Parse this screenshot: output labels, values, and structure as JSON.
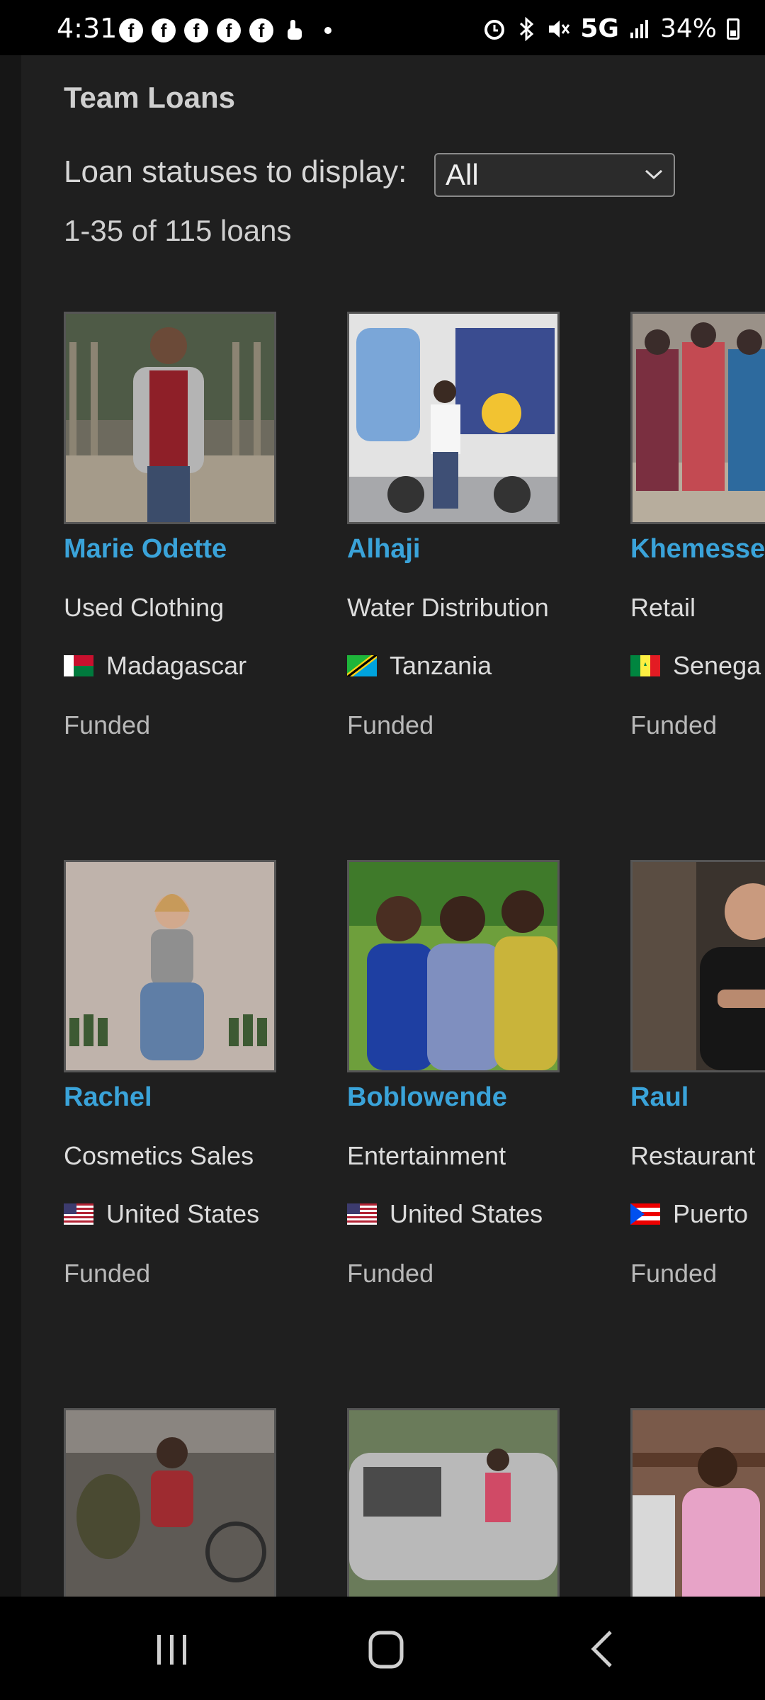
{
  "status_bar": {
    "time": "4:31",
    "network": "5G",
    "battery": "34%",
    "notification_icons": [
      "facebook-icon",
      "facebook-icon",
      "facebook-icon",
      "facebook-icon",
      "facebook-icon",
      "touch-icon"
    ]
  },
  "page": {
    "title": "Team Loans",
    "filter_label": "Loan statuses to display:",
    "filter_value": "All",
    "results_count": "1-35 of 115 loans"
  },
  "loans": [
    {
      "name": "Marie Odette",
      "sector": "Used Clothing",
      "country": "Madagascar",
      "status": "Funded",
      "flag": "madagascar"
    },
    {
      "name": "Alhaji",
      "sector": "Water Distribution",
      "country": "Tanzania",
      "status": "Funded",
      "flag": "tanzania"
    },
    {
      "name": "Khemesse",
      "sector": "Retail",
      "country": "Senega",
      "status": "Funded",
      "flag": "senegal"
    },
    {
      "name": "Rachel",
      "sector": "Cosmetics Sales",
      "country": "United States",
      "status": "Funded",
      "flag": "usa"
    },
    {
      "name": "Boblowende",
      "sector": "Entertainment",
      "country": "United States",
      "status": "Funded",
      "flag": "usa"
    },
    {
      "name": "Raul",
      "sector": "Restaurant",
      "country": "Puerto",
      "status": "Funded",
      "flag": "puerto-rico"
    },
    {
      "name": "",
      "sector": "",
      "country": "",
      "status": "",
      "flag": ""
    },
    {
      "name": "",
      "sector": "",
      "country": "",
      "status": "",
      "flag": ""
    },
    {
      "name": "",
      "sector": "",
      "country": "",
      "status": "",
      "flag": ""
    }
  ],
  "colors": {
    "background": "#1f1f1f",
    "link": "#3aa3d9",
    "text": "#dcdcdc"
  }
}
